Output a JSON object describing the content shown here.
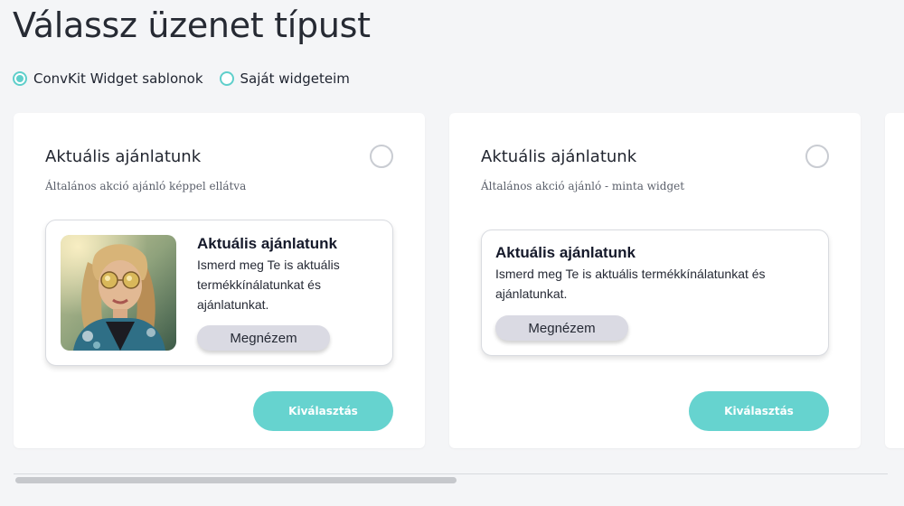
{
  "page": {
    "title": "Válassz üzenet típust"
  },
  "filter": {
    "options": [
      {
        "label": "ConvKit Widget sablonok",
        "selected": true
      },
      {
        "label": "Saját widgeteim",
        "selected": false
      }
    ]
  },
  "cards": [
    {
      "title": "Aktuális ajánlatunk",
      "subtitle": "Általános akció ajánló képpel ellátva",
      "selected": false,
      "preview": {
        "has_image": true,
        "image": "woman-with-sunglasses-photo",
        "title": "Aktuális ajánlatunk",
        "body": "Ismerd meg Te is aktuális termékkínálatunkat és ajánlatunkat.",
        "button_label": "Megnézem"
      },
      "select_label": "Kiválasztás"
    },
    {
      "title": "Aktuális ajánlatunk",
      "subtitle": "Általános akció ajánló - minta widget",
      "selected": false,
      "preview": {
        "has_image": false,
        "title": "Aktuális ajánlatunk",
        "body": "Ismerd meg Te is aktuális termékkínálatunkat és ajánlatunkat.",
        "button_label": "Megnézem"
      },
      "select_label": "Kiválasztás"
    }
  ],
  "colors": {
    "accent": "#66d3cf",
    "radio_accent": "#5fcfcb",
    "page_background": "#f4f5f7",
    "preview_button": "#dadae3"
  },
  "scrollbar": {
    "position": 0
  }
}
